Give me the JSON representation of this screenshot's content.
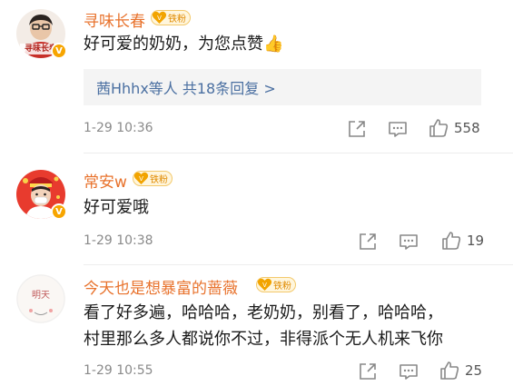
{
  "colors": {
    "username": "#e8722c",
    "reply_link": "#4a6fa1",
    "badge_gold": "#f7a500",
    "meta_gray": "#8a8a8a"
  },
  "comments": [
    {
      "username": "寻味长春",
      "fan_badge": "铁粉",
      "avatar_text": "寻味长春",
      "verified_badge": "V",
      "text": "好可爱的奶奶，为您点赞👍",
      "reply_summary": "茜Hhhx等人 共18条回复 >",
      "time": "1-29 10:36",
      "likes": "558",
      "icons": [
        "share-icon",
        "comment-icon",
        "like-icon"
      ]
    },
    {
      "username": "常安w",
      "fan_badge": "铁粉",
      "avatar_text": "",
      "verified_badge": "V",
      "text": "好可爱哦",
      "time": "1-29 10:38",
      "likes": "19",
      "icons": [
        "share-icon",
        "comment-icon",
        "like-icon"
      ]
    },
    {
      "username": "今天也是想暴富的蔷薇",
      "fan_badge": "铁粉",
      "avatar_text": "明天",
      "text_line1": "看了好多遍，哈哈哈，老奶奶，别看了，哈哈哈，",
      "text_line2": "村里那么多人都说你不过，非得派个无人机来飞你",
      "time": "1-29 10:55",
      "likes": "25",
      "icons": [
        "share-icon",
        "comment-icon",
        "like-icon"
      ]
    }
  ]
}
